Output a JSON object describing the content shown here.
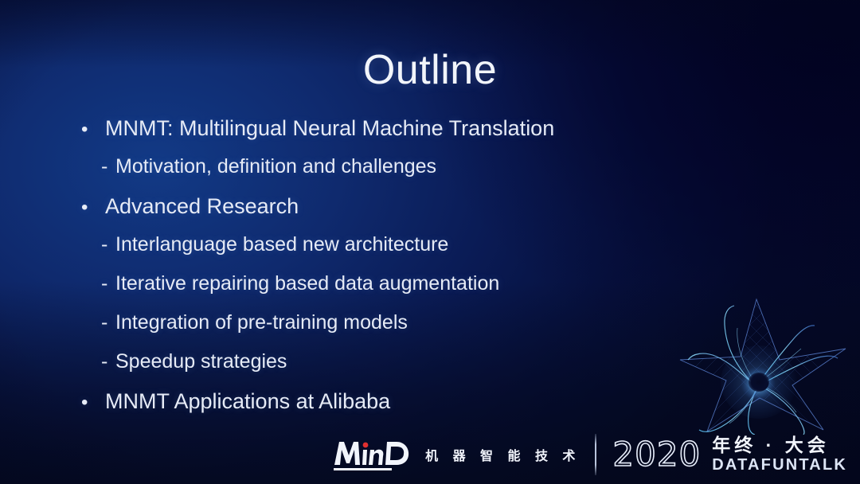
{
  "slide": {
    "title": "Outline",
    "background": {
      "top_left_color": "#0d2a63",
      "top_right_color": "#040545",
      "mid_left_color": "#0d2064",
      "bottom_color": "#0a1430",
      "text_color": "#e8ecf5"
    }
  },
  "outline": {
    "items": [
      {
        "level": 1,
        "marker": "•",
        "label": "MNMT: Multilingual Neural Machine Translation"
      },
      {
        "level": 2,
        "marker": "-",
        "label": "Motivation, definition and challenges"
      },
      {
        "level": 1,
        "marker": "•",
        "label": "Advanced Research"
      },
      {
        "level": 2,
        "marker": "-",
        "label": "Interlanguage based new architecture"
      },
      {
        "level": 2,
        "marker": "-",
        "label": "Iterative repairing based data augmentation"
      },
      {
        "level": 2,
        "marker": "-",
        "label": "Integration of pre-training models"
      },
      {
        "level": 2,
        "marker": "-",
        "label": "Speedup strategies"
      },
      {
        "level": 1,
        "marker": "•",
        "label": "MNMT Applications at Alibaba"
      }
    ]
  },
  "footer": {
    "mind_logo_text": "MinD",
    "mind_subtitle_cn": "机 器 智 能 技 术",
    "event_year": "2020",
    "event_name_cn": "年终 · 大会",
    "event_name_en": "DATAFUNTALK",
    "accent_color": "#6ec6ff"
  },
  "decoration": {
    "star_name": "wireframe-star-graphic",
    "star_line_color": "#4f7fe0",
    "star_highlight_color": "#7fd4ff"
  }
}
